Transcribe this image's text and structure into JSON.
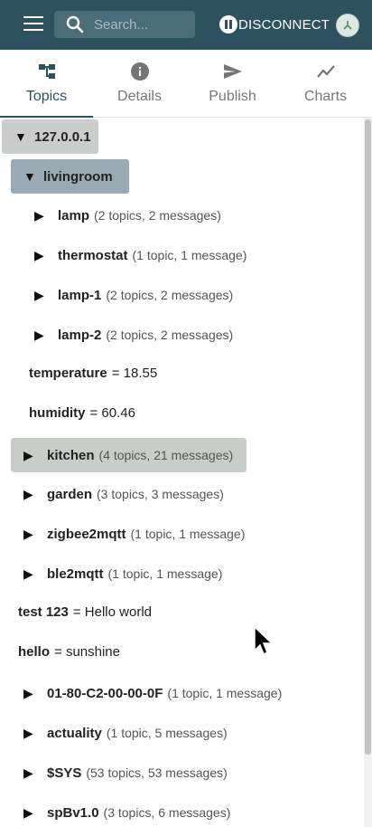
{
  "appbar": {
    "search_placeholder": "Search...",
    "disconnect_label": "DISCONNECT",
    "colors": {
      "bar": "#2c5260",
      "accent": "#2c5260"
    }
  },
  "tabs": [
    {
      "label": "Topics",
      "icon": "topics-tree-icon",
      "active": true
    },
    {
      "label": "Details",
      "icon": "info-icon"
    },
    {
      "label": "Publish",
      "icon": "send-icon"
    },
    {
      "label": "Charts",
      "icon": "chart-line-icon"
    }
  ],
  "tree": [
    {
      "arrow": "▼",
      "name": "127.0.0.1",
      "meta": ""
    },
    {
      "arrow": "▼",
      "name": "livingroom",
      "meta": ""
    },
    {
      "arrow": "▶",
      "name": "lamp",
      "meta": "(2 topics, 2 messages)"
    },
    {
      "arrow": "▶",
      "name": "thermostat",
      "meta": "(1 topic, 1 message)"
    },
    {
      "arrow": "▶",
      "name": "lamp-1",
      "meta": "(2 topics, 2 messages)"
    },
    {
      "arrow": "▶",
      "name": "lamp-2",
      "meta": "(2 topics, 2 messages)"
    },
    {
      "name": "temperature",
      "value": "= 18.55"
    },
    {
      "name": "humidity",
      "value": "= 60.46"
    },
    {
      "arrow": "▶",
      "name": "kitchen",
      "meta": "(4 topics, 21 messages)"
    },
    {
      "arrow": "▶",
      "name": "garden",
      "meta": "(3 topics, 3 messages)"
    },
    {
      "arrow": "▶",
      "name": "zigbee2mqtt",
      "meta": "(1 topic, 1 message)"
    },
    {
      "arrow": "▶",
      "name": "ble2mqtt",
      "meta": "(1 topic, 1 message)"
    },
    {
      "name": "test 123",
      "value": "= Hello world"
    },
    {
      "name": "hello",
      "value": "= sunshine"
    },
    {
      "arrow": "▶",
      "name": "01-80-C2-00-00-0F",
      "meta": "(1 topic, 1 message)"
    },
    {
      "arrow": "▶",
      "name": "actuality",
      "meta": "(1 topic, 5 messages)"
    },
    {
      "arrow": "▶",
      "name": "$SYS",
      "meta": "(53 topics, 53 messages)"
    },
    {
      "arrow": "▶",
      "name": "spBv1.0",
      "meta": "(3 topics, 6 messages)"
    }
  ]
}
